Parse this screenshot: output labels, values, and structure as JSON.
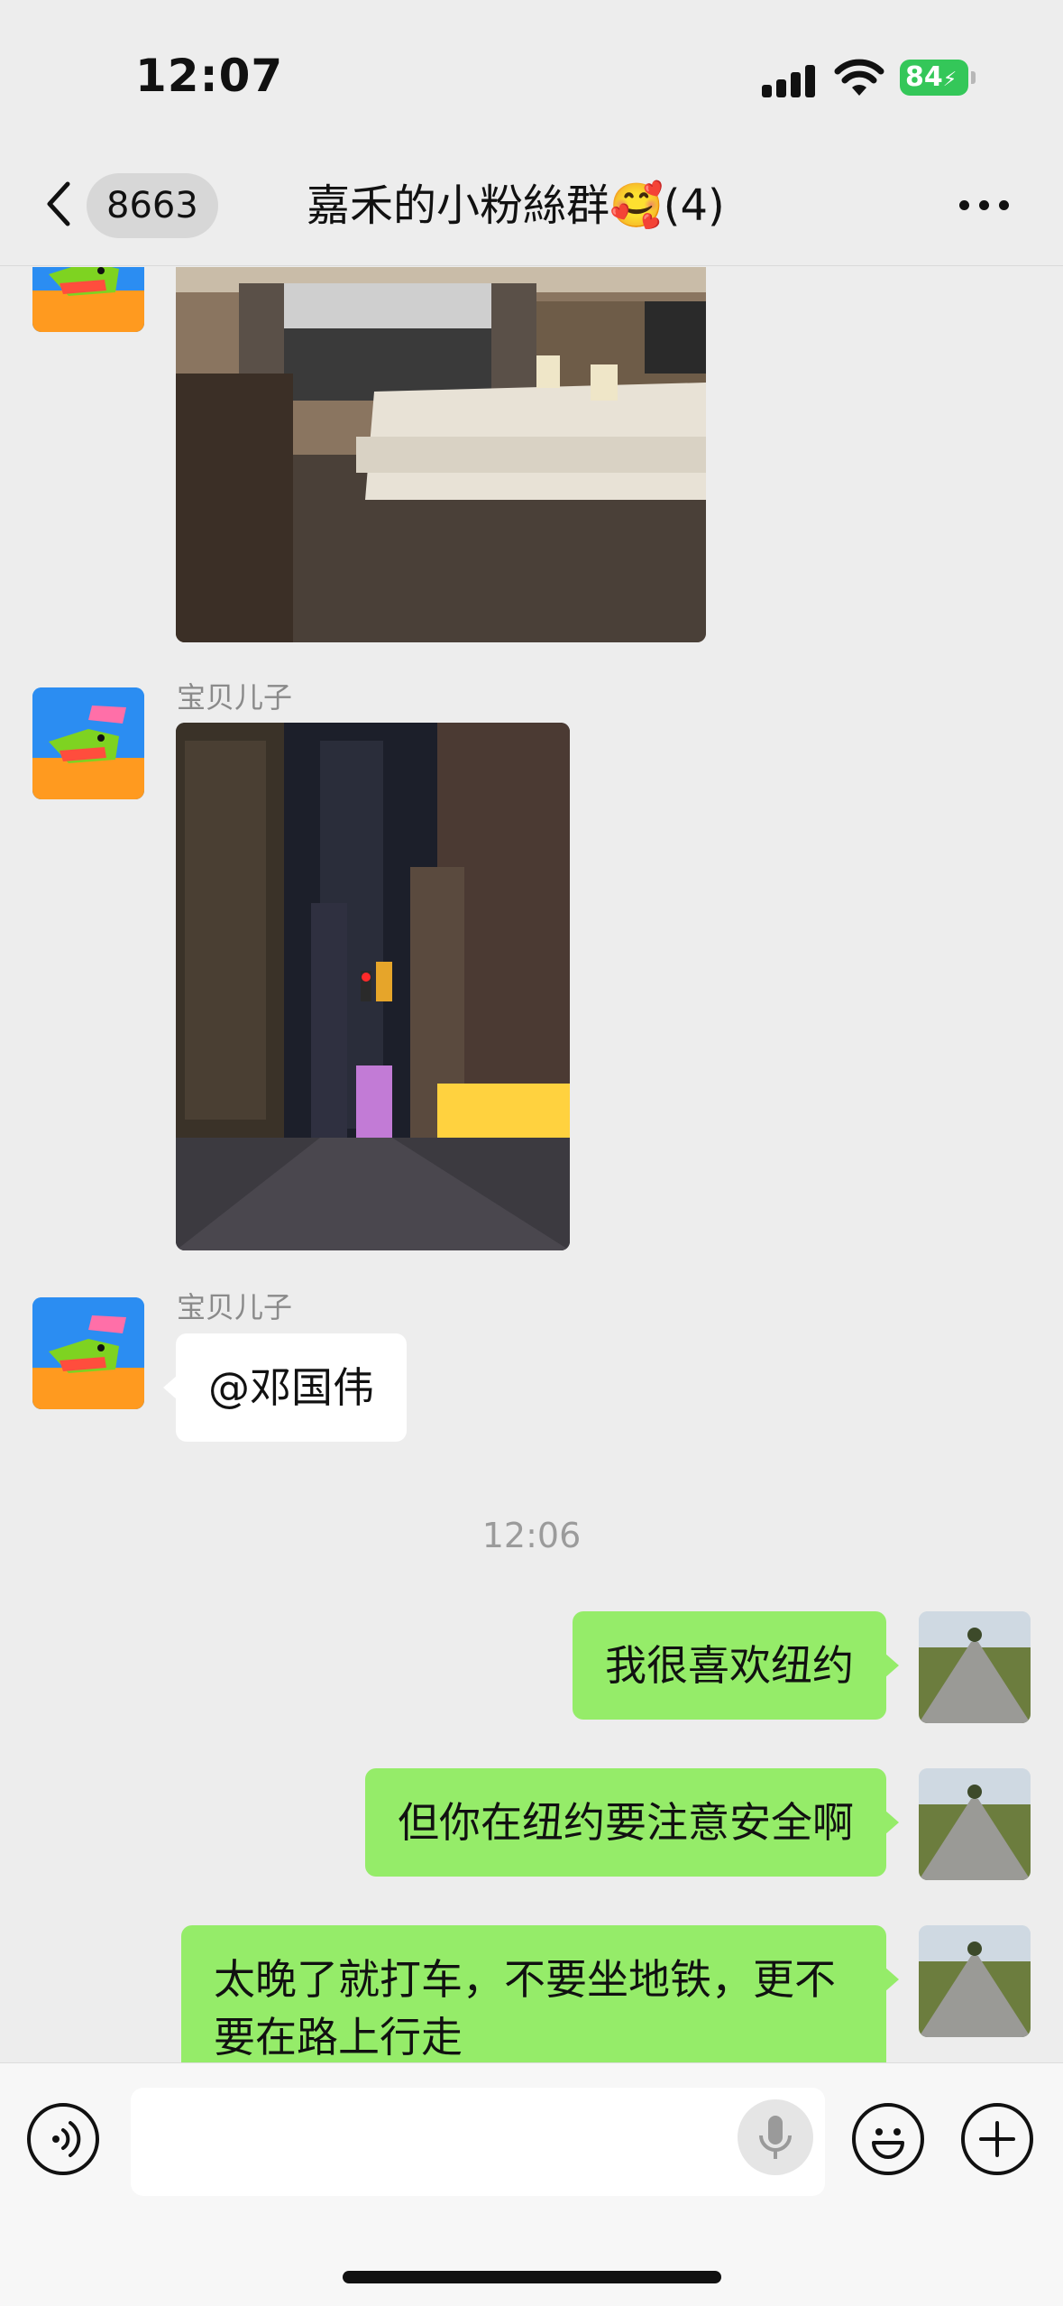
{
  "status_bar": {
    "time": "12:07",
    "battery": "84"
  },
  "header": {
    "unread_count": "8663",
    "title": "嘉禾的小粉絲群🥰(4)"
  },
  "messages": {
    "sender_1": "宝贝儿子",
    "sender_2": "宝贝儿子",
    "mention_text": "@邓国伟",
    "timestamp": "12:06",
    "out_1": "我很喜欢纽约",
    "out_2": "但你在纽约要注意安全啊",
    "out_3": "太晚了就打车，不要坐地铁，更不要在路上行走"
  },
  "icons": {
    "back": "chevron-left-icon",
    "more": "more-dots-icon",
    "voice": "voice-mode-icon",
    "mic": "microphone-icon",
    "emoji": "emoji-icon",
    "plus": "plus-icon"
  },
  "colors": {
    "background": "#ededed",
    "outgoing_bubble": "#95ec69",
    "incoming_bubble": "#ffffff",
    "battery": "#34c759"
  }
}
